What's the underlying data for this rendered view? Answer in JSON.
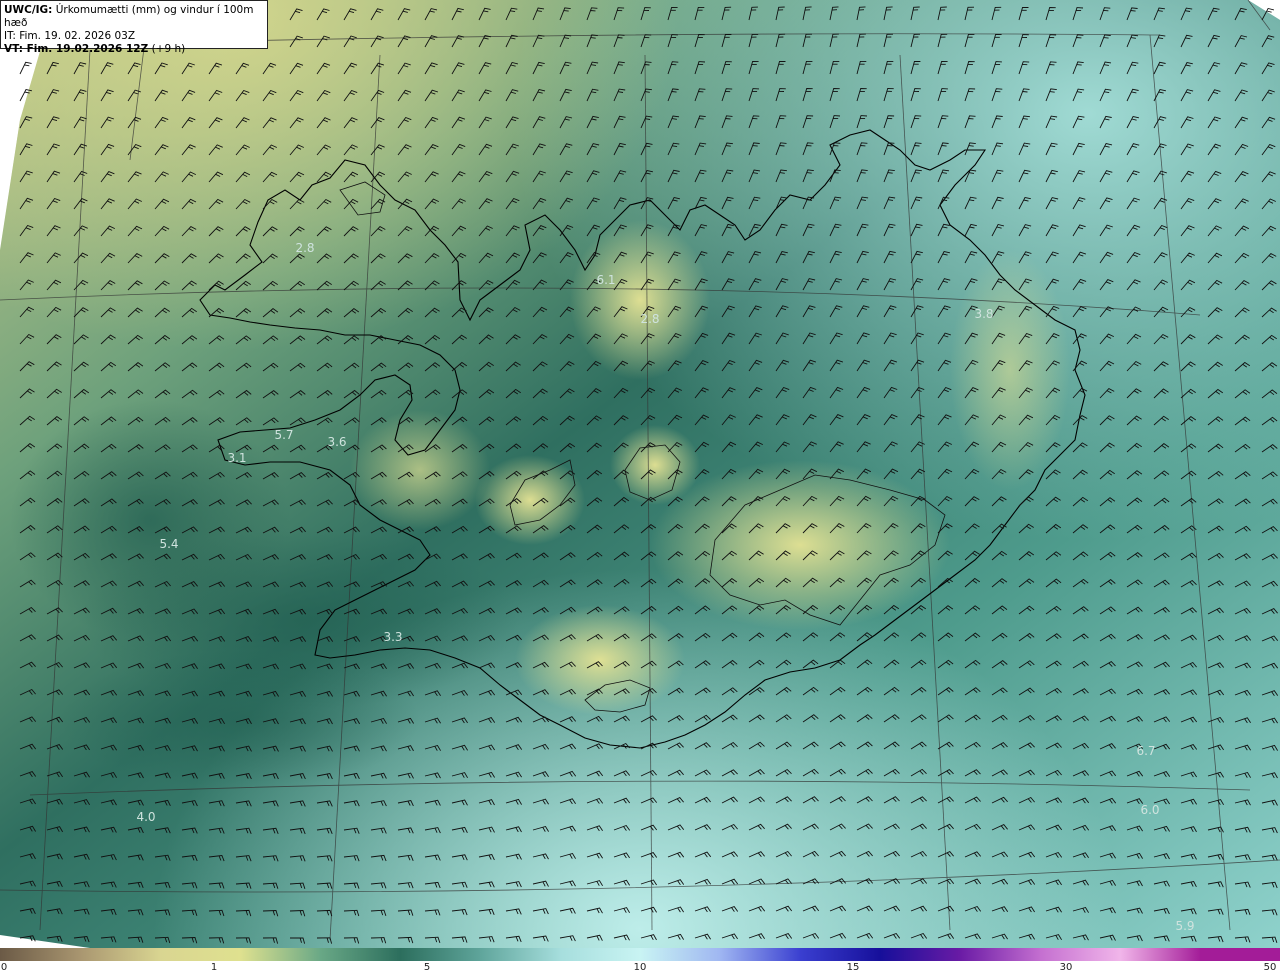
{
  "header": {
    "model": "UWC/IG:",
    "title": "Úrkomumætti (mm) og vindur í 100m hæð",
    "init_time": "IT: Fim. 19. 02. 2026 03Z",
    "valid_time_bold": "VT: Fim. 19.02.2026 12Z",
    "valid_offset": "(+9 h)"
  },
  "point_values": [
    {
      "value": "2.8"
    },
    {
      "value": "6.1"
    },
    {
      "value": "2.8"
    },
    {
      "value": "3.8"
    },
    {
      "value": "5.7"
    },
    {
      "value": "3.6"
    },
    {
      "value": "3.1"
    },
    {
      "value": "5.4"
    },
    {
      "value": "3.3"
    },
    {
      "value": "4.0"
    },
    {
      "value": "6.7"
    },
    {
      "value": "6.0"
    },
    {
      "value": "5.9"
    }
  ],
  "colorbar": {
    "ticks": [
      "0",
      "1",
      "5",
      "10",
      "15",
      "30",
      "50"
    ],
    "colors": [
      "#6b5a46",
      "#a99670",
      "#d9d591",
      "#dfe18f",
      "#69a886",
      "#2c6e5d",
      "#5fa59b",
      "#a6dedd",
      "#c9f4f3",
      "#9fb6f2",
      "#3a3fd0",
      "#160f9a",
      "#6a1ba5",
      "#c46fd0",
      "#f1b6ea",
      "#a31c98"
    ]
  },
  "wind": {
    "direction_word": "SSW-southwesterly barbs",
    "barb_color": "#111111"
  }
}
